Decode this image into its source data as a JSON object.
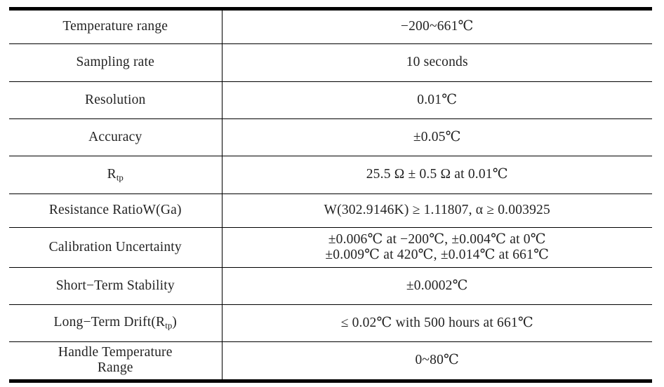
{
  "document": {
    "type": "specification-table",
    "columns": 2,
    "row_count": 10,
    "text_color": "#232323",
    "rule_color": "#000000",
    "background": "#ffffff"
  },
  "table": {
    "rows": [
      {
        "parameter": "Temperature range",
        "parameter_lines": [
          "Temperature range"
        ],
        "value": "−200~661℃",
        "value_lines": [
          "−200~661℃"
        ]
      },
      {
        "parameter": "Sampling rate",
        "parameter_lines": [
          "Sampling rate"
        ],
        "value": "10 seconds",
        "value_lines": [
          "10 seconds"
        ]
      },
      {
        "parameter": "Resolution",
        "parameter_lines": [
          "Resolution"
        ],
        "value": "0.01℃",
        "value_lines": [
          "0.01℃"
        ]
      },
      {
        "parameter": "Accuracy",
        "parameter_lines": [
          "Accuracy"
        ],
        "value": "±0.05℃",
        "value_lines": [
          "±0.05℃"
        ]
      },
      {
        "parameter": "Rtp",
        "parameter_base": "R",
        "parameter_subscript": "tp",
        "parameter_lines": [
          "Rtp"
        ],
        "value": "25.5 Ω ± 0.5 Ω at 0.01℃",
        "value_lines": [
          "25.5 Ω ± 0.5 Ω at 0.01℃"
        ]
      },
      {
        "parameter": "Resistance RatioW(Ga)",
        "parameter_lines": [
          "Resistance RatioW(Ga)"
        ],
        "value": "W(302.9146K) ≥ 1.11807, α ≥ 0.003925",
        "value_lines": [
          "W(302.9146K) ≥ 1.11807, α ≥ 0.003925"
        ]
      },
      {
        "parameter": "Calibration Uncertainty",
        "parameter_lines": [
          "Calibration Uncertainty"
        ],
        "value": "±0.006℃ at −200℃, ±0.004℃ at 0℃ ±0.009℃ at 420℃, ±0.014℃ at 661℃",
        "value_lines": [
          "±0.006℃ at −200℃, ±0.004℃ at 0℃",
          "±0.009℃ at 420℃, ±0.014℃ at 661℃"
        ]
      },
      {
        "parameter": "Short−Term Stability",
        "parameter_lines": [
          "Short−Term Stability"
        ],
        "value": "±0.0002℃",
        "value_lines": [
          "±0.0002℃"
        ]
      },
      {
        "parameter": "Long−Term Drift(Rtp)",
        "parameter_prefix": "Long−Term Drift(R",
        "parameter_subscript": "tp",
        "parameter_suffix": ")",
        "parameter_lines": [
          "Long−Term Drift(Rtp)"
        ],
        "value": "≤ 0.02℃ with 500 hours at 661℃",
        "value_lines": [
          "≤ 0.02℃ with 500 hours at 661℃"
        ]
      },
      {
        "parameter": "Handle Temperature Range",
        "parameter_lines": [
          "Handle Temperature",
          "Range"
        ],
        "value": "0~80℃",
        "value_lines": [
          "0~80℃"
        ]
      }
    ]
  }
}
